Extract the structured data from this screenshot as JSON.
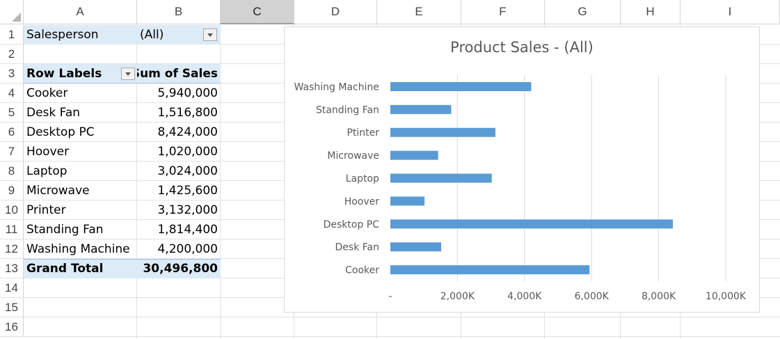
{
  "columns": [
    "A",
    "B",
    "C",
    "D",
    "E",
    "F",
    "G",
    "H",
    "I"
  ],
  "selected_column": "C",
  "rows": [
    "1",
    "2",
    "3",
    "4",
    "5",
    "6",
    "7",
    "8",
    "9",
    "10",
    "11",
    "12",
    "13",
    "14",
    "15",
    "16"
  ],
  "filter": {
    "label": "Salesperson",
    "value": "(All)"
  },
  "pivot": {
    "row_labels_header": "Row Labels",
    "sum_header": "Sum of Sales",
    "items": [
      {
        "label": "Cooker",
        "value": "5,940,000"
      },
      {
        "label": "Desk Fan",
        "value": "1,516,800"
      },
      {
        "label": "Desktop PC",
        "value": "8,424,000"
      },
      {
        "label": "Hoover",
        "value": "1,020,000"
      },
      {
        "label": "Laptop",
        "value": "3,024,000"
      },
      {
        "label": "Microwave",
        "value": "1,425,600"
      },
      {
        "label": "Printer",
        "value": "3,132,000"
      },
      {
        "label": "Standing Fan",
        "value": "1,814,400"
      },
      {
        "label": "Washing Machine",
        "value": "4,200,000"
      }
    ],
    "grand_total_label": "Grand Total",
    "grand_total_value": "30,496,800"
  },
  "colors": {
    "bar": "#5b9bd5",
    "header_fill": "#ddebf7",
    "gridline": "#d9d9d9"
  },
  "chart_data": {
    "type": "bar",
    "orientation": "horizontal",
    "title": "Product Sales - (All)",
    "categories": [
      "Washing Machine",
      "Standing Fan",
      "Ptinter",
      "Microwave",
      "Laptop",
      "Hoover",
      "Desktop PC",
      "Desk Fan",
      "Cooker"
    ],
    "values": [
      4200000,
      1814400,
      3132000,
      1425600,
      3024000,
      1020000,
      8424000,
      1516800,
      5940000
    ],
    "xlim": [
      0,
      10000000
    ],
    "tick_values": [
      0,
      2000000,
      4000000,
      6000000,
      8000000,
      10000000
    ],
    "tick_labels": [
      "-",
      "2,000K",
      "4,000K",
      "6,000K",
      "8,000K",
      "10,000K"
    ],
    "grid": true,
    "legend": "none"
  }
}
